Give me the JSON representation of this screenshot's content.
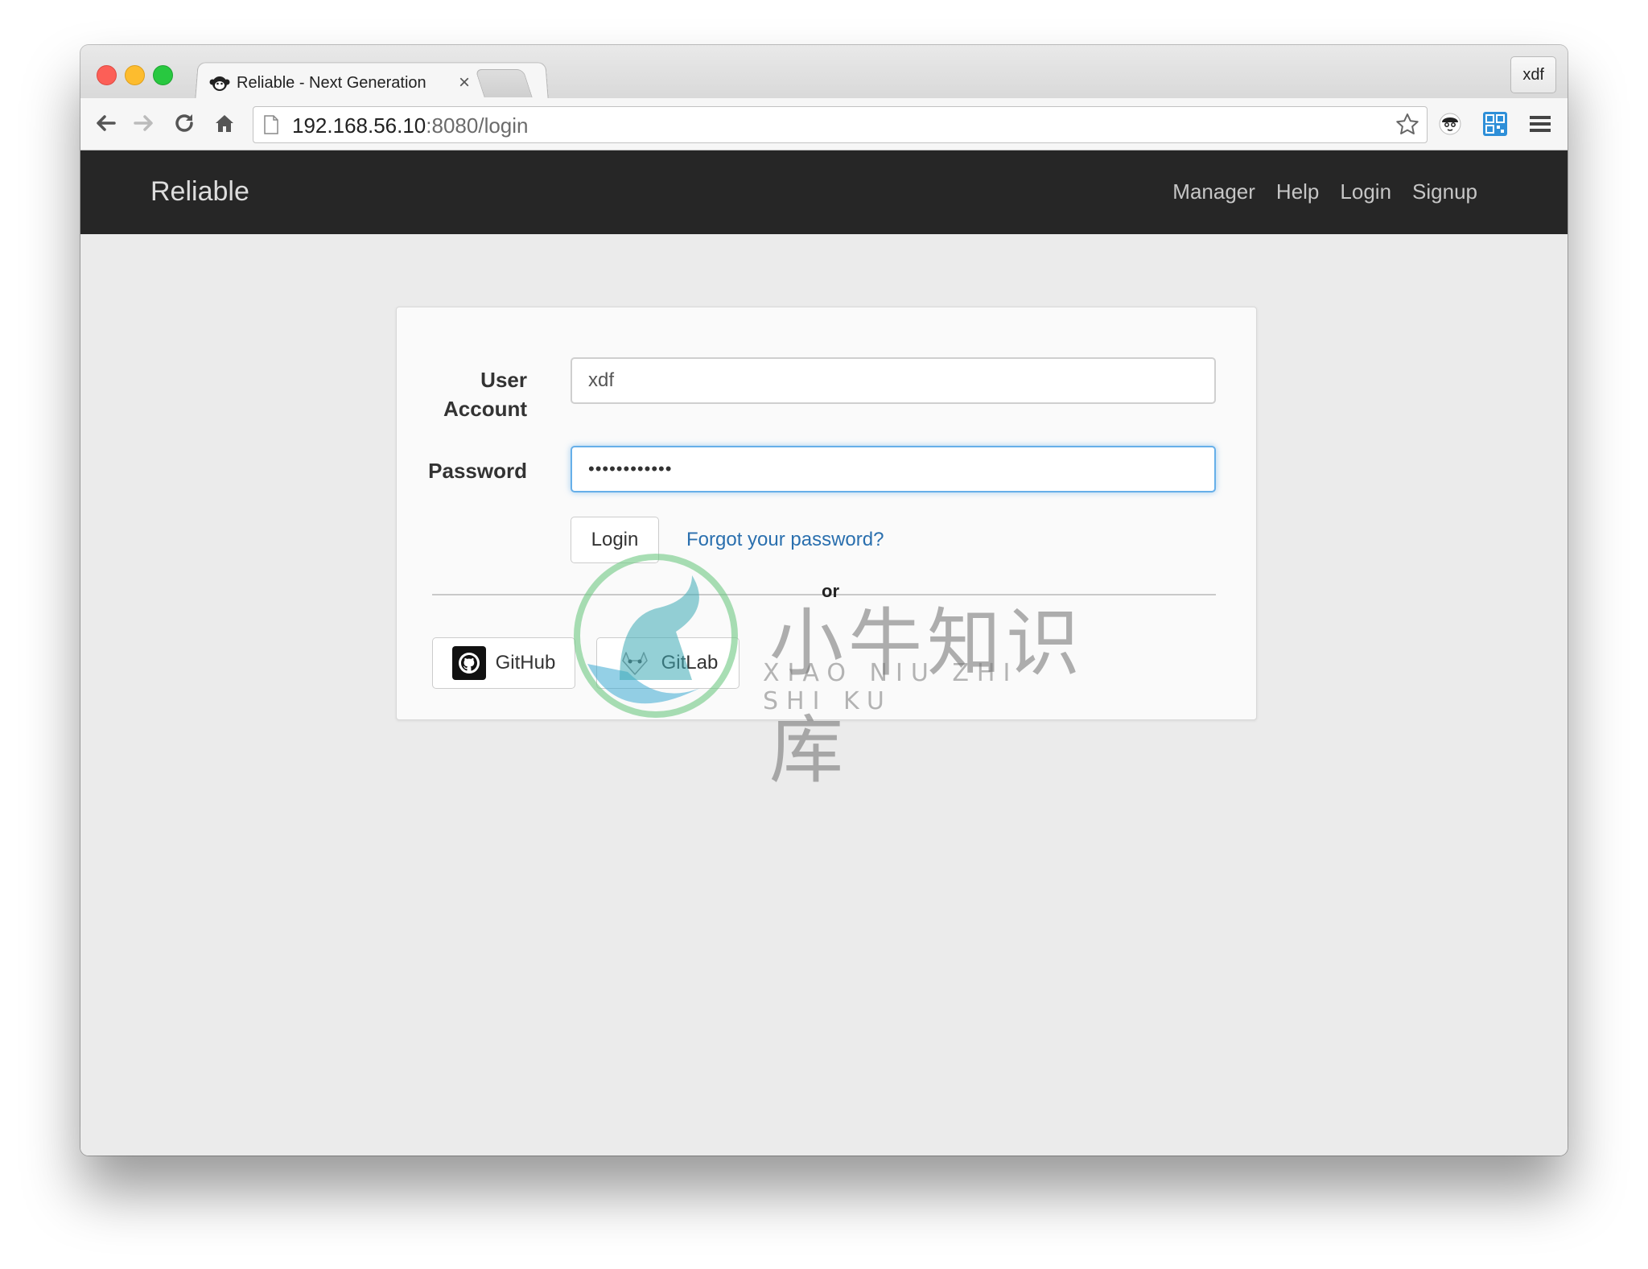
{
  "browser": {
    "tab_title": "Reliable - Next Generation",
    "tab_close": "×",
    "profile_name": "xdf",
    "url_host": "192.168.56.10",
    "url_path": ":8080/login"
  },
  "app": {
    "brand": "Reliable",
    "nav": [
      "Manager",
      "Help",
      "Login",
      "Signup"
    ]
  },
  "login_form": {
    "user_label_line1": "User",
    "user_label_line2": "Account",
    "user_value": "xdf",
    "password_label": "Password",
    "password_mask": "••••••••••••",
    "login_button": "Login",
    "forgot_link": "Forgot your password?",
    "or_text": "or",
    "github_button": "GitHub",
    "gitlab_button": "GitLab"
  },
  "watermark": {
    "cn": "小牛知识库",
    "en": "XIAO NIU ZHI SHI KU"
  },
  "colors": {
    "navbar_bg": "#262626",
    "link": "#2a6fae",
    "focus": "#66afe9"
  }
}
